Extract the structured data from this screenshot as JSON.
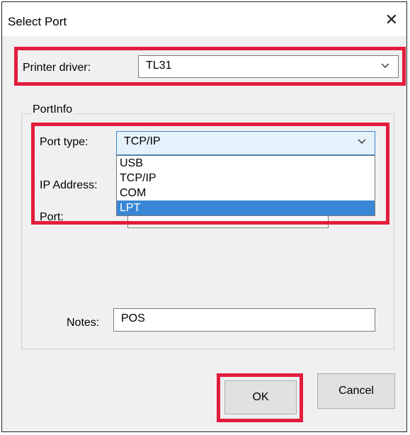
{
  "dialog": {
    "title": "Select Port",
    "close_glyph": "✕"
  },
  "printer_driver": {
    "label": "Printer driver:",
    "value": "TL31"
  },
  "port_info": {
    "group_label": "PortInfo",
    "port_type_label": "Port type:",
    "port_type_value": "TCP/IP",
    "port_type_options": [
      "USB",
      "TCP/IP",
      "COM",
      "LPT"
    ],
    "highlighted_option": "LPT",
    "ip_address_label": "IP Address:",
    "port_label": "Port:",
    "notes_label": "Notes:",
    "notes_value": "POS"
  },
  "buttons": {
    "ok": "OK",
    "cancel": "Cancel"
  },
  "colors": {
    "highlight": "#e31c3d",
    "selection": "#3a86d6",
    "dialog_bg": "#f0f0f0"
  },
  "icons": {
    "close": "close-icon",
    "dropdown": "chevron-down-icon"
  }
}
